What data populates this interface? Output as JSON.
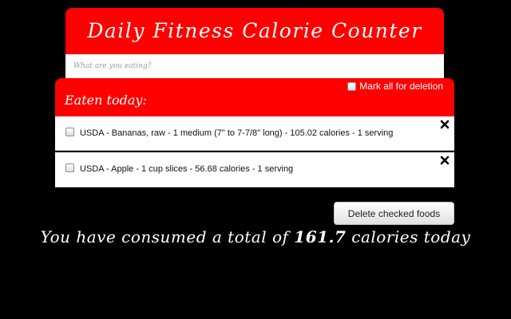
{
  "app": {
    "title": "Daily Fitness Calorie Counter"
  },
  "search": {
    "placeholder": "What are you eating?",
    "value": ""
  },
  "eaten": {
    "heading": "Eaten today:",
    "mark_all_label": "Mark all for deletion",
    "mark_all_checked": false,
    "items": [
      {
        "text": "USDA - Bananas, raw - 1 medium (7\" to 7-7/8\" long) - 105.02 calories - 1 serving",
        "checked": false,
        "remove_icon": "close-icon"
      },
      {
        "text": "USDA - Apple - 1 cup slices - 56.68 calories - 1 serving",
        "checked": false,
        "remove_icon": "close-icon"
      }
    ]
  },
  "actions": {
    "delete_label": "Delete checked foods"
  },
  "summary": {
    "prefix": "You have consumed a total of ",
    "total": "161.7",
    "suffix": " calories today"
  },
  "colors": {
    "background": "#000000",
    "accent": "#ff0000",
    "panel": "#ffffff",
    "text_light": "#ffffff"
  }
}
